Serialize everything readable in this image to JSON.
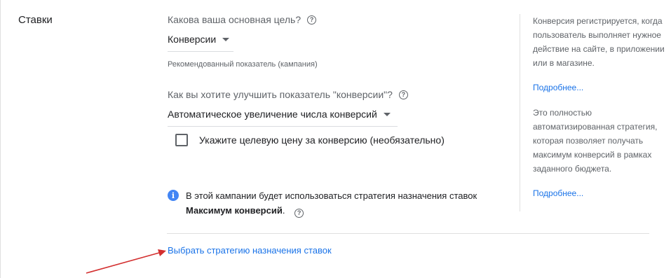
{
  "section": {
    "title": "Ставки"
  },
  "goal": {
    "question": "Какова ваша основная цель?",
    "selected": "Конверсии",
    "helper": "Рекомендованный показатель (кампания)"
  },
  "improve": {
    "question": "Как вы хотите улучшить показатель \"конверсии\"?",
    "selected": "Автоматическое увеличение числа конверсий"
  },
  "target_cpa": {
    "label": "Укажите целевую цену за конверсию (необязательно)",
    "checked": false
  },
  "info": {
    "text": "В этой кампании будет использоваться стратегия назначения ставок",
    "strategy": "Максимум конверсий",
    "suffix": "."
  },
  "sidebar": {
    "block1_text": "Конверсия регистрируется, когда пользователь выполняет нужное действие на сайте, в приложении или в магазине.",
    "block1_link": "Подробнее...",
    "block2_text": "Это полностью автоматизированная стратегия, которая позволяет получать максимум конверсий в рамках заданного бюджета.",
    "block2_link": "Подробнее..."
  },
  "footer": {
    "link": "Выбрать стратегию назначения ставок"
  },
  "colors": {
    "link": "#1a73e8",
    "info_icon": "#4285f4",
    "arrow": "#d32f2f"
  },
  "icons": {
    "help": "help-circle-icon",
    "dropdown": "caret-down-icon",
    "info": "info-icon"
  }
}
